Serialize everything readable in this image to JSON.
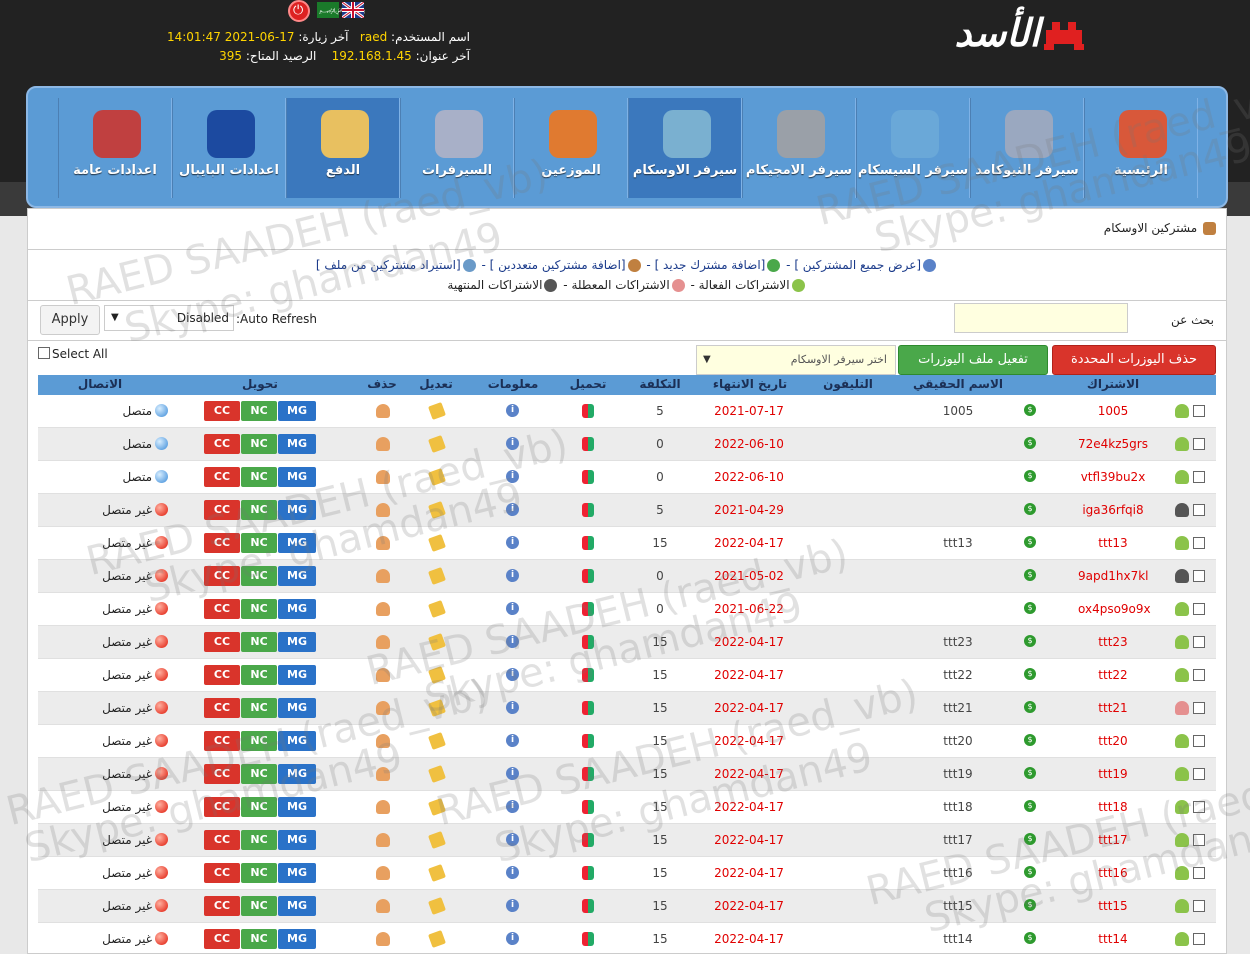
{
  "header": {
    "logo_text": "الأسد",
    "user_label": "اسم المستخدم:",
    "user_value": "raed",
    "visit_label": "آخر زيارة:",
    "visit_value": "17-06-2021 14:01:47",
    "ip_label": "آخر عنوان:",
    "ip_value": "192.168.1.45",
    "balance_label": "الرصيد المتاح:",
    "balance_value": "395",
    "icons": [
      "power-icon",
      "flag-arabic-icon",
      "flag-uk-icon"
    ]
  },
  "nav": [
    {
      "label": "الرئيسية",
      "icon": "home-icon"
    },
    {
      "label": "سيرفر النيوكامد",
      "icon": "newcamd-server-icon"
    },
    {
      "label": "سيرفر السيسكام",
      "icon": "cccam-server-icon"
    },
    {
      "label": "سيرفر الامجيكام",
      "icon": "mgcamd-server-icon"
    },
    {
      "label": "سيرفر الاوسكام",
      "icon": "oscam-server-icon",
      "active": true
    },
    {
      "label": "الموزعين",
      "icon": "resellers-icon"
    },
    {
      "label": "السيرفرات",
      "icon": "satellite-icon"
    },
    {
      "label": "الدفع",
      "icon": "payment-icon",
      "active": true
    },
    {
      "label": "اعدادات البايبال",
      "icon": "paypal-icon"
    },
    {
      "label": "اعدادات عامة",
      "icon": "tools-icon"
    }
  ],
  "breadcrumb": "مشتركين الاوسكام",
  "links": {
    "show_all": "[عرض جميع المشتركين ]",
    "add_new": "[اضافة مشترك جديد ]",
    "add_multi": "[اضافة مشتركين متعددين ]",
    "import": "[استيراد مشتركين من ملف ]",
    "active": "الاشتراكات الفعالة",
    "disabled": "الاشتراكات المعطلة",
    "expired": "الاشتراكات المنتهية"
  },
  "search": {
    "label": "بحث عن",
    "value": ""
  },
  "refresh": {
    "label": ":Auto Refresh",
    "value": "Disabled",
    "apply": "Apply"
  },
  "toolbar": {
    "select_all": "Select All",
    "delete_selected": "حذف اليوزرات المحددة",
    "activate_file": "تفعيل ملف اليوزرات",
    "server_placeholder": "اختر سيرفر الاوسكام"
  },
  "table": {
    "headers": {
      "subscription": "الاشتراك",
      "real_name": "الاسم الحقيقي",
      "phone": "التليفون",
      "expiry": "تاريخ الانتهاء",
      "cost": "التكلفة",
      "download": "تحميل",
      "info": "معلومات",
      "edit": "تعديل",
      "delete": "حذف",
      "convert": "تحويل",
      "connection": "الاتصال"
    },
    "buttons": {
      "cc": "CC",
      "nc": "NC",
      "mg": "MG"
    },
    "rows": [
      {
        "sub": "1005",
        "real": "1005",
        "phone": "",
        "expiry": "2021-07-17",
        "cost": "5",
        "conn": "متصل",
        "online": true,
        "user": "green"
      },
      {
        "sub": "72e4kz5grs",
        "real": "",
        "phone": "",
        "expiry": "2022-06-10",
        "cost": "0",
        "conn": "متصل",
        "online": true,
        "user": "green"
      },
      {
        "sub": "vtfl39bu2x",
        "real": "",
        "phone": "",
        "expiry": "2022-06-10",
        "cost": "0",
        "conn": "متصل",
        "online": true,
        "user": "green"
      },
      {
        "sub": "iga36rfqi8",
        "real": "",
        "phone": "",
        "expiry": "2021-04-29",
        "cost": "5",
        "conn": "غير متصل",
        "online": false,
        "user": "dark"
      },
      {
        "sub": "ttt13",
        "real": "ttt13",
        "phone": "",
        "expiry": "2022-04-17",
        "cost": "15",
        "conn": "غير متصل",
        "online": false,
        "user": "green"
      },
      {
        "sub": "9apd1hx7kl",
        "real": "",
        "phone": "",
        "expiry": "2021-05-02",
        "cost": "0",
        "conn": "غير متصل",
        "online": false,
        "user": "dark"
      },
      {
        "sub": "ox4pso9o9x",
        "real": "",
        "phone": "",
        "expiry": "2021-06-22",
        "cost": "0",
        "conn": "غير متصل",
        "online": false,
        "user": "green"
      },
      {
        "sub": "ttt23",
        "real": "ttt23",
        "phone": "",
        "expiry": "2022-04-17",
        "cost": "15",
        "conn": "غير متصل",
        "online": false,
        "user": "green"
      },
      {
        "sub": "ttt22",
        "real": "ttt22",
        "phone": "",
        "expiry": "2022-04-17",
        "cost": "15",
        "conn": "غير متصل",
        "online": false,
        "user": "green"
      },
      {
        "sub": "ttt21",
        "real": "ttt21",
        "phone": "",
        "expiry": "2022-04-17",
        "cost": "15",
        "conn": "غير متصل",
        "online": false,
        "user": "red"
      },
      {
        "sub": "ttt20",
        "real": "ttt20",
        "phone": "",
        "expiry": "2022-04-17",
        "cost": "15",
        "conn": "غير متصل",
        "online": false,
        "user": "green"
      },
      {
        "sub": "ttt19",
        "real": "ttt19",
        "phone": "",
        "expiry": "2022-04-17",
        "cost": "15",
        "conn": "غير متصل",
        "online": false,
        "user": "green"
      },
      {
        "sub": "ttt18",
        "real": "ttt18",
        "phone": "",
        "expiry": "2022-04-17",
        "cost": "15",
        "conn": "غير متصل",
        "online": false,
        "user": "green"
      },
      {
        "sub": "ttt17",
        "real": "ttt17",
        "phone": "",
        "expiry": "2022-04-17",
        "cost": "15",
        "conn": "غير متصل",
        "online": false,
        "user": "green"
      },
      {
        "sub": "ttt16",
        "real": "ttt16",
        "phone": "",
        "expiry": "2022-04-17",
        "cost": "15",
        "conn": "غير متصل",
        "online": false,
        "user": "green"
      },
      {
        "sub": "ttt15",
        "real": "ttt15",
        "phone": "",
        "expiry": "2022-04-17",
        "cost": "15",
        "conn": "غير متصل",
        "online": false,
        "user": "green"
      },
      {
        "sub": "ttt14",
        "real": "ttt14",
        "phone": "",
        "expiry": "2022-04-17",
        "cost": "15",
        "conn": "غير متصل",
        "online": false,
        "user": "green"
      }
    ]
  },
  "watermark": [
    "RAED SAADEH (raed_vb)",
    "Skype: ghamdan49"
  ],
  "colors": {
    "nav_bg": "#5b9bd5",
    "accent_red": "#e00000",
    "btn_cc": "#d9342b",
    "btn_nc": "#4aa84a",
    "btn_mg": "#2a72c8"
  }
}
